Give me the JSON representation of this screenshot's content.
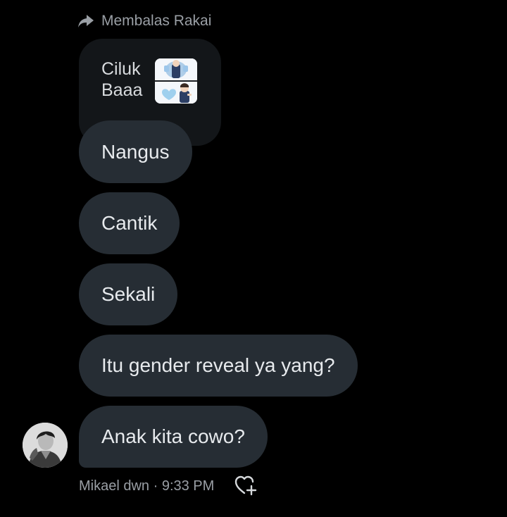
{
  "reply_header": {
    "label": "Membalas Rakai",
    "icon": "reply-arrow-icon"
  },
  "quoted_message": {
    "text": "Ciluk\nBaaa",
    "thumbnails": [
      "sticker-top",
      "sticker-bottom"
    ]
  },
  "messages": [
    {
      "text": "Nangus"
    },
    {
      "text": "Cantik"
    },
    {
      "text": "Sekali"
    },
    {
      "text": "Itu gender reveal ya yang?"
    },
    {
      "text": "Anak kita cowo?"
    }
  ],
  "sender": {
    "name": "Mikael dwn",
    "separator": " · ",
    "time": "9:33 PM"
  },
  "icons": {
    "reply": "reply-arrow-icon",
    "add_reaction": "heart-plus-icon"
  },
  "colors": {
    "background": "#000000",
    "bubble": "#262d34",
    "quoted_bubble": "#131619",
    "muted_text": "#9a9fa5"
  }
}
